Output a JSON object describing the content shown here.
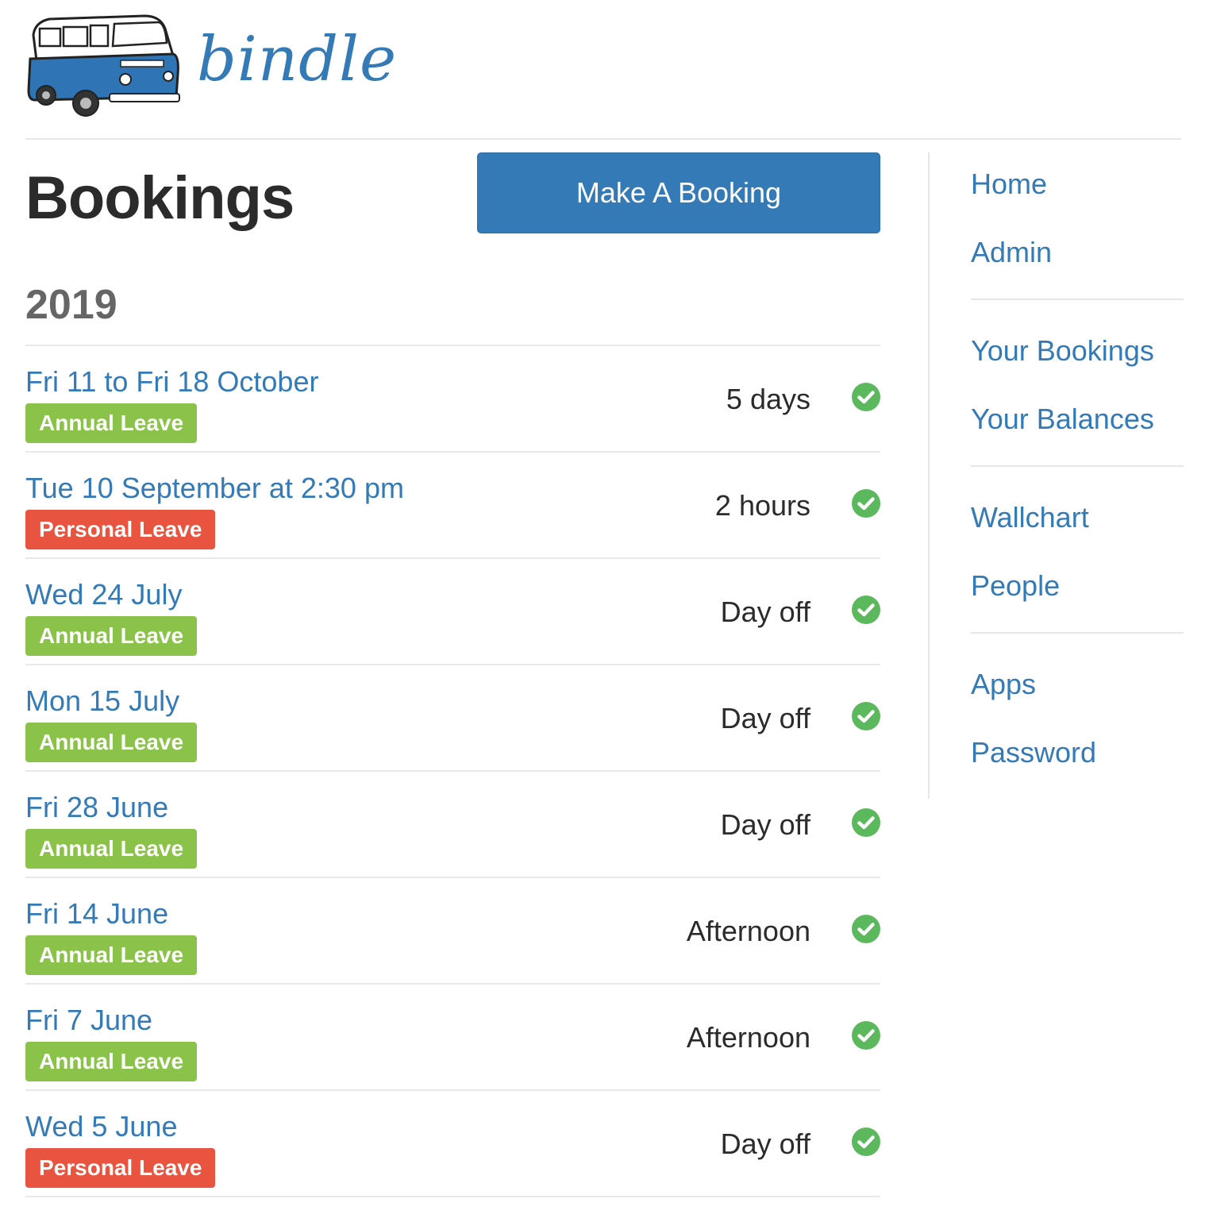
{
  "header": {
    "logo_text": "bindle"
  },
  "main": {
    "title": "Bookings",
    "make_booking_label": "Make A Booking",
    "year": "2019",
    "bookings": [
      {
        "date": "Fri 11 to Fri 18 October",
        "type": "Annual Leave",
        "duration": "5 days",
        "status_icon": "check-circle-icon"
      },
      {
        "date": "Tue 10 September at 2:30 pm",
        "type": "Personal Leave",
        "duration": "2 hours",
        "status_icon": "check-circle-icon"
      },
      {
        "date": "Wed 24 July",
        "type": "Annual Leave",
        "duration": "Day off",
        "status_icon": "check-circle-icon"
      },
      {
        "date": "Mon 15 July",
        "type": "Annual Leave",
        "duration": "Day off",
        "status_icon": "check-circle-icon"
      },
      {
        "date": "Fri 28 June",
        "type": "Annual Leave",
        "duration": "Day off",
        "status_icon": "check-circle-icon"
      },
      {
        "date": "Fri 14 June",
        "type": "Annual Leave",
        "duration": "Afternoon",
        "status_icon": "check-circle-icon"
      },
      {
        "date": "Fri 7 June",
        "type": "Annual Leave",
        "duration": "Afternoon",
        "status_icon": "check-circle-icon"
      },
      {
        "date": "Wed 5 June",
        "type": "Personal Leave",
        "duration": "Day off",
        "status_icon": "check-circle-icon"
      }
    ]
  },
  "sidebar": {
    "groups": [
      [
        {
          "label": "Home"
        },
        {
          "label": "Admin"
        }
      ],
      [
        {
          "label": "Your Bookings"
        },
        {
          "label": "Your Balances"
        }
      ],
      [
        {
          "label": "Wallchart"
        },
        {
          "label": "People"
        }
      ],
      [
        {
          "label": "Apps"
        },
        {
          "label": "Password"
        }
      ]
    ]
  },
  "colors": {
    "link": "#337ab7",
    "primary_button": "#337ab7",
    "annual_leave": "#8bc34a",
    "personal_leave": "#e8543f",
    "approved": "#5cb85c",
    "van_body": "#2f74b5"
  }
}
